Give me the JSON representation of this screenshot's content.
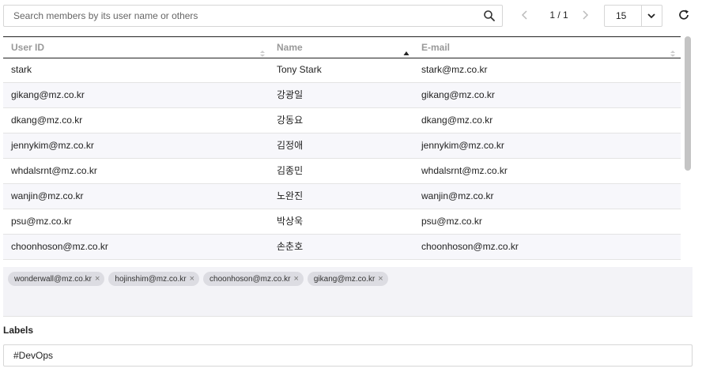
{
  "search": {
    "placeholder": "Search members by its user name or others",
    "value": "",
    "icon": "search-icon"
  },
  "pagination": {
    "page_info": "1 / 1",
    "prev_icon": "chevron-left-icon",
    "next_icon": "chevron-right-icon"
  },
  "page_size": {
    "value": "15",
    "icon": "chevron-down-icon"
  },
  "refresh": {
    "icon": "refresh-icon"
  },
  "table": {
    "columns": [
      {
        "label": "User ID",
        "sort": "none"
      },
      {
        "label": "Name",
        "sort": "ascending"
      },
      {
        "label": "E-mail",
        "sort": "none"
      }
    ],
    "rows": [
      {
        "user_id": "stark",
        "name": "Tony Stark",
        "email": "stark@mz.co.kr"
      },
      {
        "user_id": "gikang@mz.co.kr",
        "name": "강광일",
        "email": "gikang@mz.co.kr"
      },
      {
        "user_id": "dkang@mz.co.kr",
        "name": "강동요",
        "email": "dkang@mz.co.kr"
      },
      {
        "user_id": "jennykim@mz.co.kr",
        "name": "김정애",
        "email": "jennykim@mz.co.kr"
      },
      {
        "user_id": "whdalsrnt@mz.co.kr",
        "name": "김종민",
        "email": "whdalsrnt@mz.co.kr"
      },
      {
        "user_id": "wanjin@mz.co.kr",
        "name": "노완진",
        "email": "wanjin@mz.co.kr"
      },
      {
        "user_id": "psu@mz.co.kr",
        "name": "박상욱",
        "email": "psu@mz.co.kr"
      },
      {
        "user_id": "choonhoson@mz.co.kr",
        "name": "손춘호",
        "email": "choonhoson@mz.co.kr"
      }
    ]
  },
  "selected_members": {
    "remove_icon": "close-icon",
    "chips": [
      "wonderwall@mz.co.kr",
      "hojinshim@mz.co.kr",
      "choonhoson@mz.co.kr",
      "gikang@mz.co.kr"
    ]
  },
  "labels": {
    "title": "Labels",
    "value": "#DevOps"
  },
  "colors": {
    "header_text": "#999999",
    "row_alt": "#f7f7fb",
    "chip_bg": "#dcdce2",
    "chips_area": "#f3f3f7"
  }
}
